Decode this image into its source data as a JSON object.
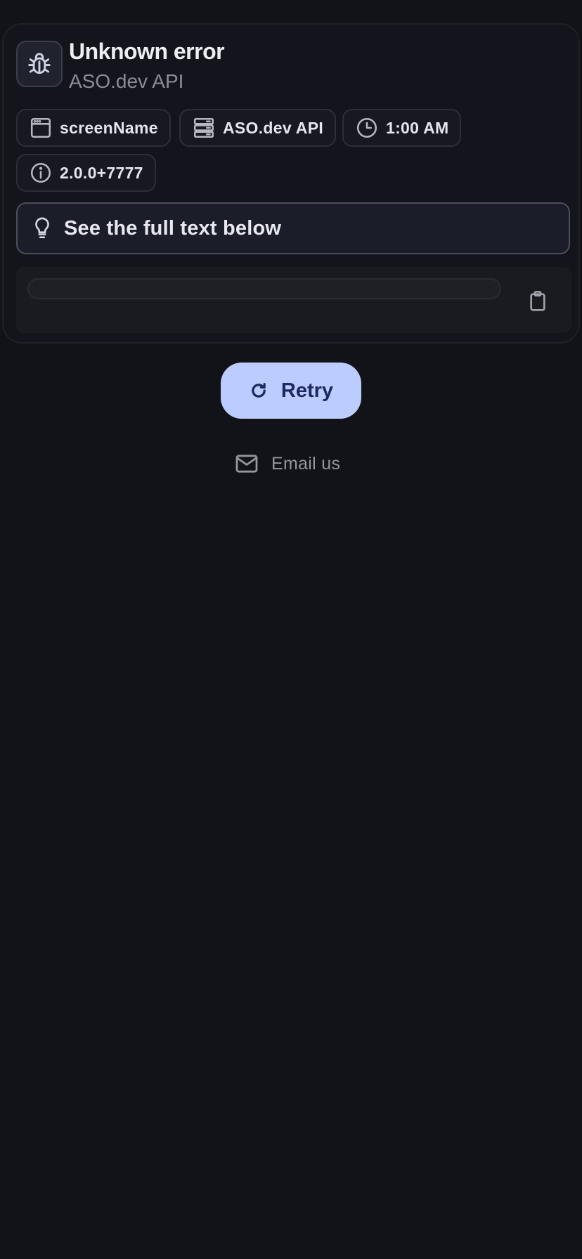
{
  "error": {
    "title": "Unknown error",
    "source": "ASO.dev API",
    "icon": "bug-icon"
  },
  "chips": [
    {
      "icon": "window-icon",
      "label": "screenName"
    },
    {
      "icon": "server-icon",
      "label": "ASO.dev API"
    },
    {
      "icon": "clock-icon",
      "label": "1:00 AM"
    },
    {
      "icon": "info-icon",
      "label": "2.0.0+7777"
    }
  ],
  "hint": {
    "icon": "lightbulb-icon",
    "text": "See the full text below"
  },
  "details": {
    "text": "",
    "copy_icon": "clipboard-icon"
  },
  "actions": {
    "retry_label": "Retry",
    "retry_icon": "refresh-icon",
    "email_label": "Email us",
    "email_icon": "mail-icon"
  },
  "colors": {
    "background": "#121319",
    "accent": "#bcccff",
    "accent_text": "#1c2b5c"
  }
}
